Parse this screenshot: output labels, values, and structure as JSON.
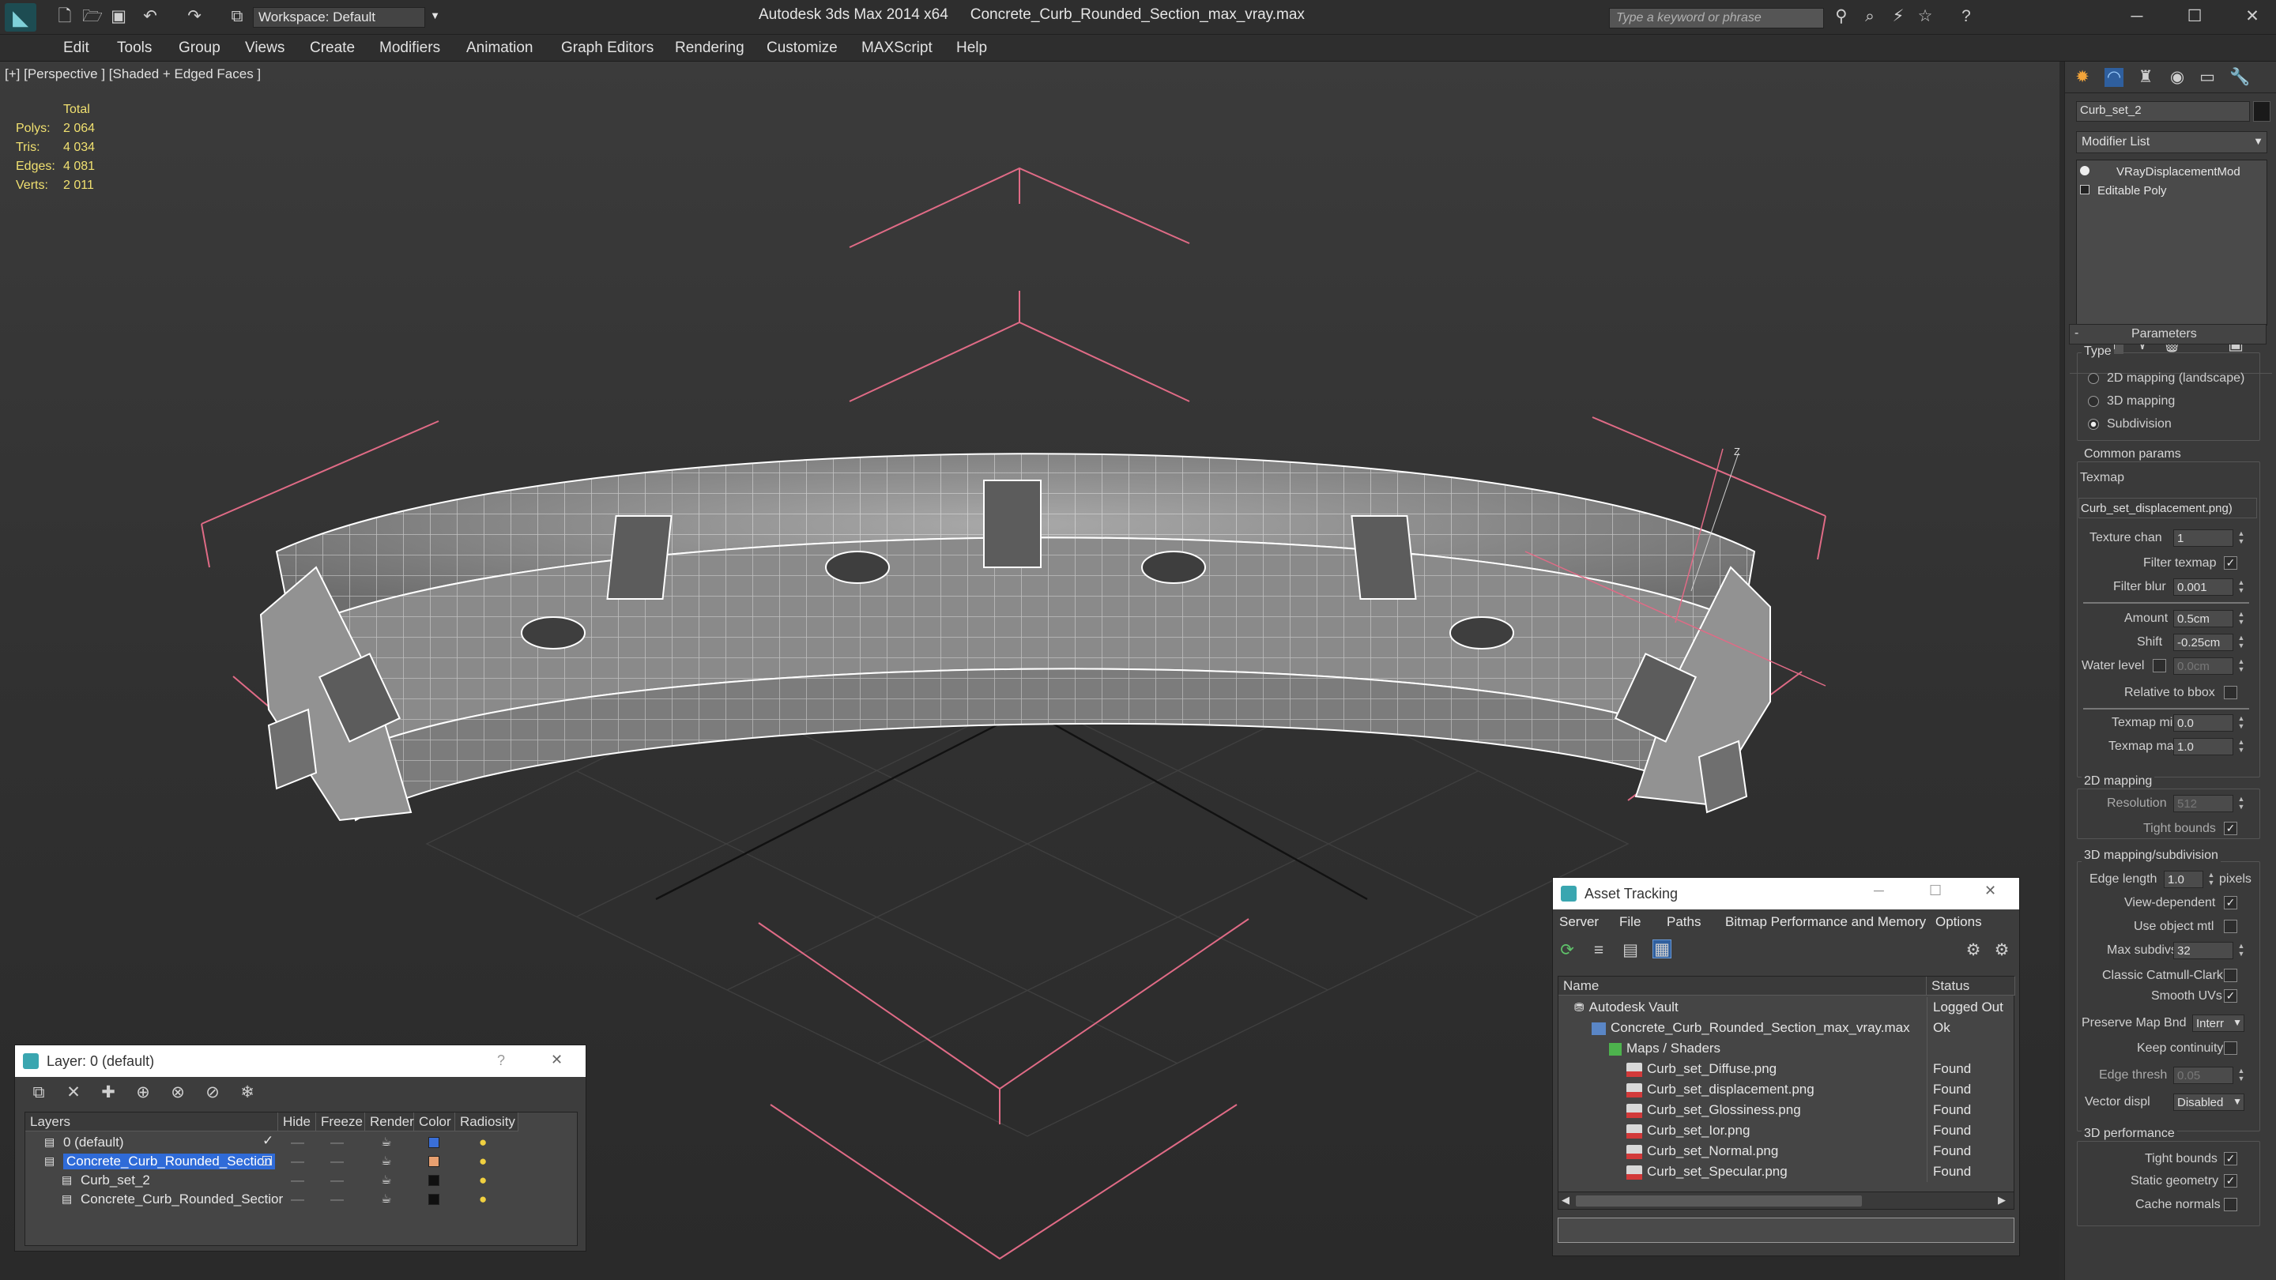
{
  "app": {
    "title": "Autodesk 3ds Max 2014 x64",
    "file": "Concrete_Curb_Rounded_Section_max_vray.max",
    "workspace": "Workspace: Default",
    "search_placeholder": "Type a keyword or phrase"
  },
  "menu": [
    "Edit",
    "Tools",
    "Group",
    "Views",
    "Create",
    "Modifiers",
    "Animation",
    "Graph Editors",
    "Rendering",
    "Customize",
    "MAXScript",
    "Help"
  ],
  "viewport": {
    "label": "[+] [Perspective ] [Shaded + Edged Faces ]",
    "stats": {
      "header": "Total",
      "rows": [
        {
          "k": "Polys:",
          "v": "2 064"
        },
        {
          "k": "Tris:",
          "v": "4 034"
        },
        {
          "k": "Edges:",
          "v": "4 081"
        },
        {
          "k": "Verts:",
          "v": "2 011"
        }
      ]
    },
    "axis_label": "Z"
  },
  "command_panel": {
    "object_name": "Curb_set_2",
    "modifier_list": "Modifier List",
    "stack": [
      "VRayDisplacementMod",
      "Editable Poly"
    ],
    "rollout": "Parameters",
    "type": {
      "label": "Type",
      "options": [
        "2D mapping (landscape)",
        "3D mapping",
        "Subdivision"
      ],
      "selected": 2
    },
    "common": {
      "label": "Common params",
      "texmap_label": "Texmap",
      "texmap": "Curb_set_displacement.png)",
      "texture_chan_label": "Texture chan",
      "texture_chan": "1",
      "filter_texmap": "Filter texmap",
      "filter_blur_label": "Filter blur",
      "filter_blur": "0.001",
      "amount_label": "Amount",
      "amount": "0.5cm",
      "shift_label": "Shift",
      "shift": "-0.25cm",
      "water_label": "Water level",
      "water": "0.0cm",
      "relative": "Relative to bbox",
      "texmap_min_label": "Texmap min",
      "texmap_min": "0.0",
      "texmap_max_label": "Texmap max",
      "texmap_max": "1.0"
    },
    "mapping2d": {
      "label": "2D mapping",
      "resolution_label": "Resolution",
      "resolution": "512",
      "tight": "Tight bounds"
    },
    "mapping3d": {
      "label": "3D mapping/subdivision",
      "edge_length_label": "Edge length",
      "edge_length": "1.0",
      "pixels": "pixels",
      "view_dependent": "View-dependent",
      "use_object_mtl": "Use object mtl",
      "max_subdivs_label": "Max subdivs",
      "max_subdivs": "32",
      "catmull": "Classic Catmull-Clark",
      "smooth_uvs": "Smooth UVs",
      "preserve_label": "Preserve Map Bnd",
      "preserve": "Interr",
      "keep": "Keep continuity",
      "edge_thresh_label": "Edge thresh",
      "edge_thresh": "0.05",
      "vector_label": "Vector displ",
      "vector": "Disabled"
    },
    "performance": {
      "label": "3D performance",
      "tight": "Tight bounds",
      "static": "Static geometry",
      "cache": "Cache normals"
    }
  },
  "layer_window": {
    "title": "Layer: 0 (default)",
    "help": "?",
    "columns": [
      "Layers",
      "Hide",
      "Freeze",
      "Render",
      "Color",
      "Radiosity"
    ],
    "rows": [
      {
        "name": "0 (default)",
        "color": "#3a6fd8",
        "indent": 0,
        "selected": false
      },
      {
        "name": "Concrete_Curb_Rounded_Section",
        "color": "#e8a070",
        "indent": 0,
        "selected": true
      },
      {
        "name": "Curb_set_2",
        "color": "#101010",
        "indent": 1,
        "selected": false
      },
      {
        "name": "Concrete_Curb_Rounded_Sectior",
        "color": "#101010",
        "indent": 1,
        "selected": false
      }
    ]
  },
  "asset_window": {
    "title": "Asset Tracking",
    "menu": [
      "Server",
      "File",
      "Paths",
      "Bitmap Performance and Memory",
      "Options"
    ],
    "columns": [
      "Name",
      "Status"
    ],
    "rows": [
      {
        "name": "Autodesk Vault",
        "status": "Logged Out",
        "indent": 0
      },
      {
        "name": "Concrete_Curb_Rounded_Section_max_vray.max",
        "status": "Ok",
        "indent": 1
      },
      {
        "name": "Maps / Shaders",
        "status": "",
        "indent": 2
      },
      {
        "name": "Curb_set_Diffuse.png",
        "status": "Found",
        "indent": 3
      },
      {
        "name": "Curb_set_displacement.png",
        "status": "Found",
        "indent": 3
      },
      {
        "name": "Curb_set_Glossiness.png",
        "status": "Found",
        "indent": 3
      },
      {
        "name": "Curb_set_Ior.png",
        "status": "Found",
        "indent": 3
      },
      {
        "name": "Curb_set_Normal.png",
        "status": "Found",
        "indent": 3
      },
      {
        "name": "Curb_set_Specular.png",
        "status": "Found",
        "indent": 3
      }
    ]
  }
}
